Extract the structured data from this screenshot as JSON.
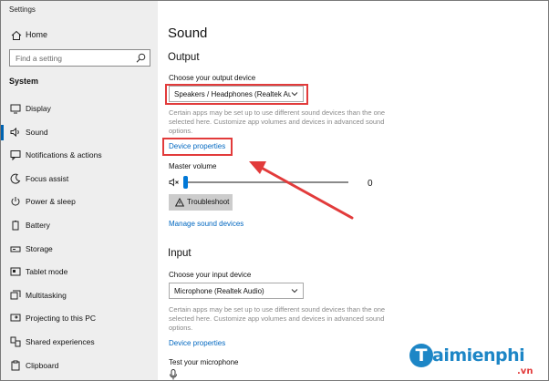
{
  "window": {
    "title": "Settings"
  },
  "sidebar": {
    "home_label": "Home",
    "search_placeholder": "Find a setting",
    "section_label": "System",
    "items": [
      {
        "label": "Display",
        "icon": "display-icon",
        "active": false
      },
      {
        "label": "Sound",
        "icon": "speaker-icon",
        "active": true
      },
      {
        "label": "Notifications & actions",
        "icon": "notification-icon",
        "active": false
      },
      {
        "label": "Focus assist",
        "icon": "moon-icon",
        "active": false
      },
      {
        "label": "Power & sleep",
        "icon": "power-icon",
        "active": false
      },
      {
        "label": "Battery",
        "icon": "battery-icon",
        "active": false
      },
      {
        "label": "Storage",
        "icon": "storage-icon",
        "active": false
      },
      {
        "label": "Tablet mode",
        "icon": "tablet-icon",
        "active": false
      },
      {
        "label": "Multitasking",
        "icon": "multitasking-icon",
        "active": false
      },
      {
        "label": "Projecting to this PC",
        "icon": "projector-icon",
        "active": false
      },
      {
        "label": "Shared experiences",
        "icon": "shared-icon",
        "active": false
      },
      {
        "label": "Clipboard",
        "icon": "clipboard-icon",
        "active": false
      }
    ]
  },
  "main": {
    "title": "Sound",
    "output": {
      "heading": "Output",
      "device_label": "Choose your output device",
      "device_value": "Speakers / Headphones (Realtek Au...",
      "note": "Certain apps may be set up to use different sound devices than the one selected here. Customize app volumes and devices in advanced sound options.",
      "properties_link": "Device properties",
      "master_volume_label": "Master volume",
      "volume_value": "0",
      "volume_level": 0,
      "troubleshoot_label": "Troubleshoot",
      "manage_link": "Manage sound devices"
    },
    "input": {
      "heading": "Input",
      "device_label": "Choose your input device",
      "device_value": "Microphone (Realtek Audio)",
      "note": "Certain apps may be set up to use different sound devices than the one selected here. Customize app volumes and devices in advanced sound options.",
      "properties_link": "Device properties",
      "test_label": "Test your microphone"
    }
  },
  "watermark": {
    "brand": "aimienphi",
    "letter": "T",
    "suffix": ".vn"
  },
  "colors": {
    "accent": "#0078d7",
    "link": "#0067c0",
    "highlight": "#e23b3b",
    "sidebar_bg": "#eeeeee"
  }
}
